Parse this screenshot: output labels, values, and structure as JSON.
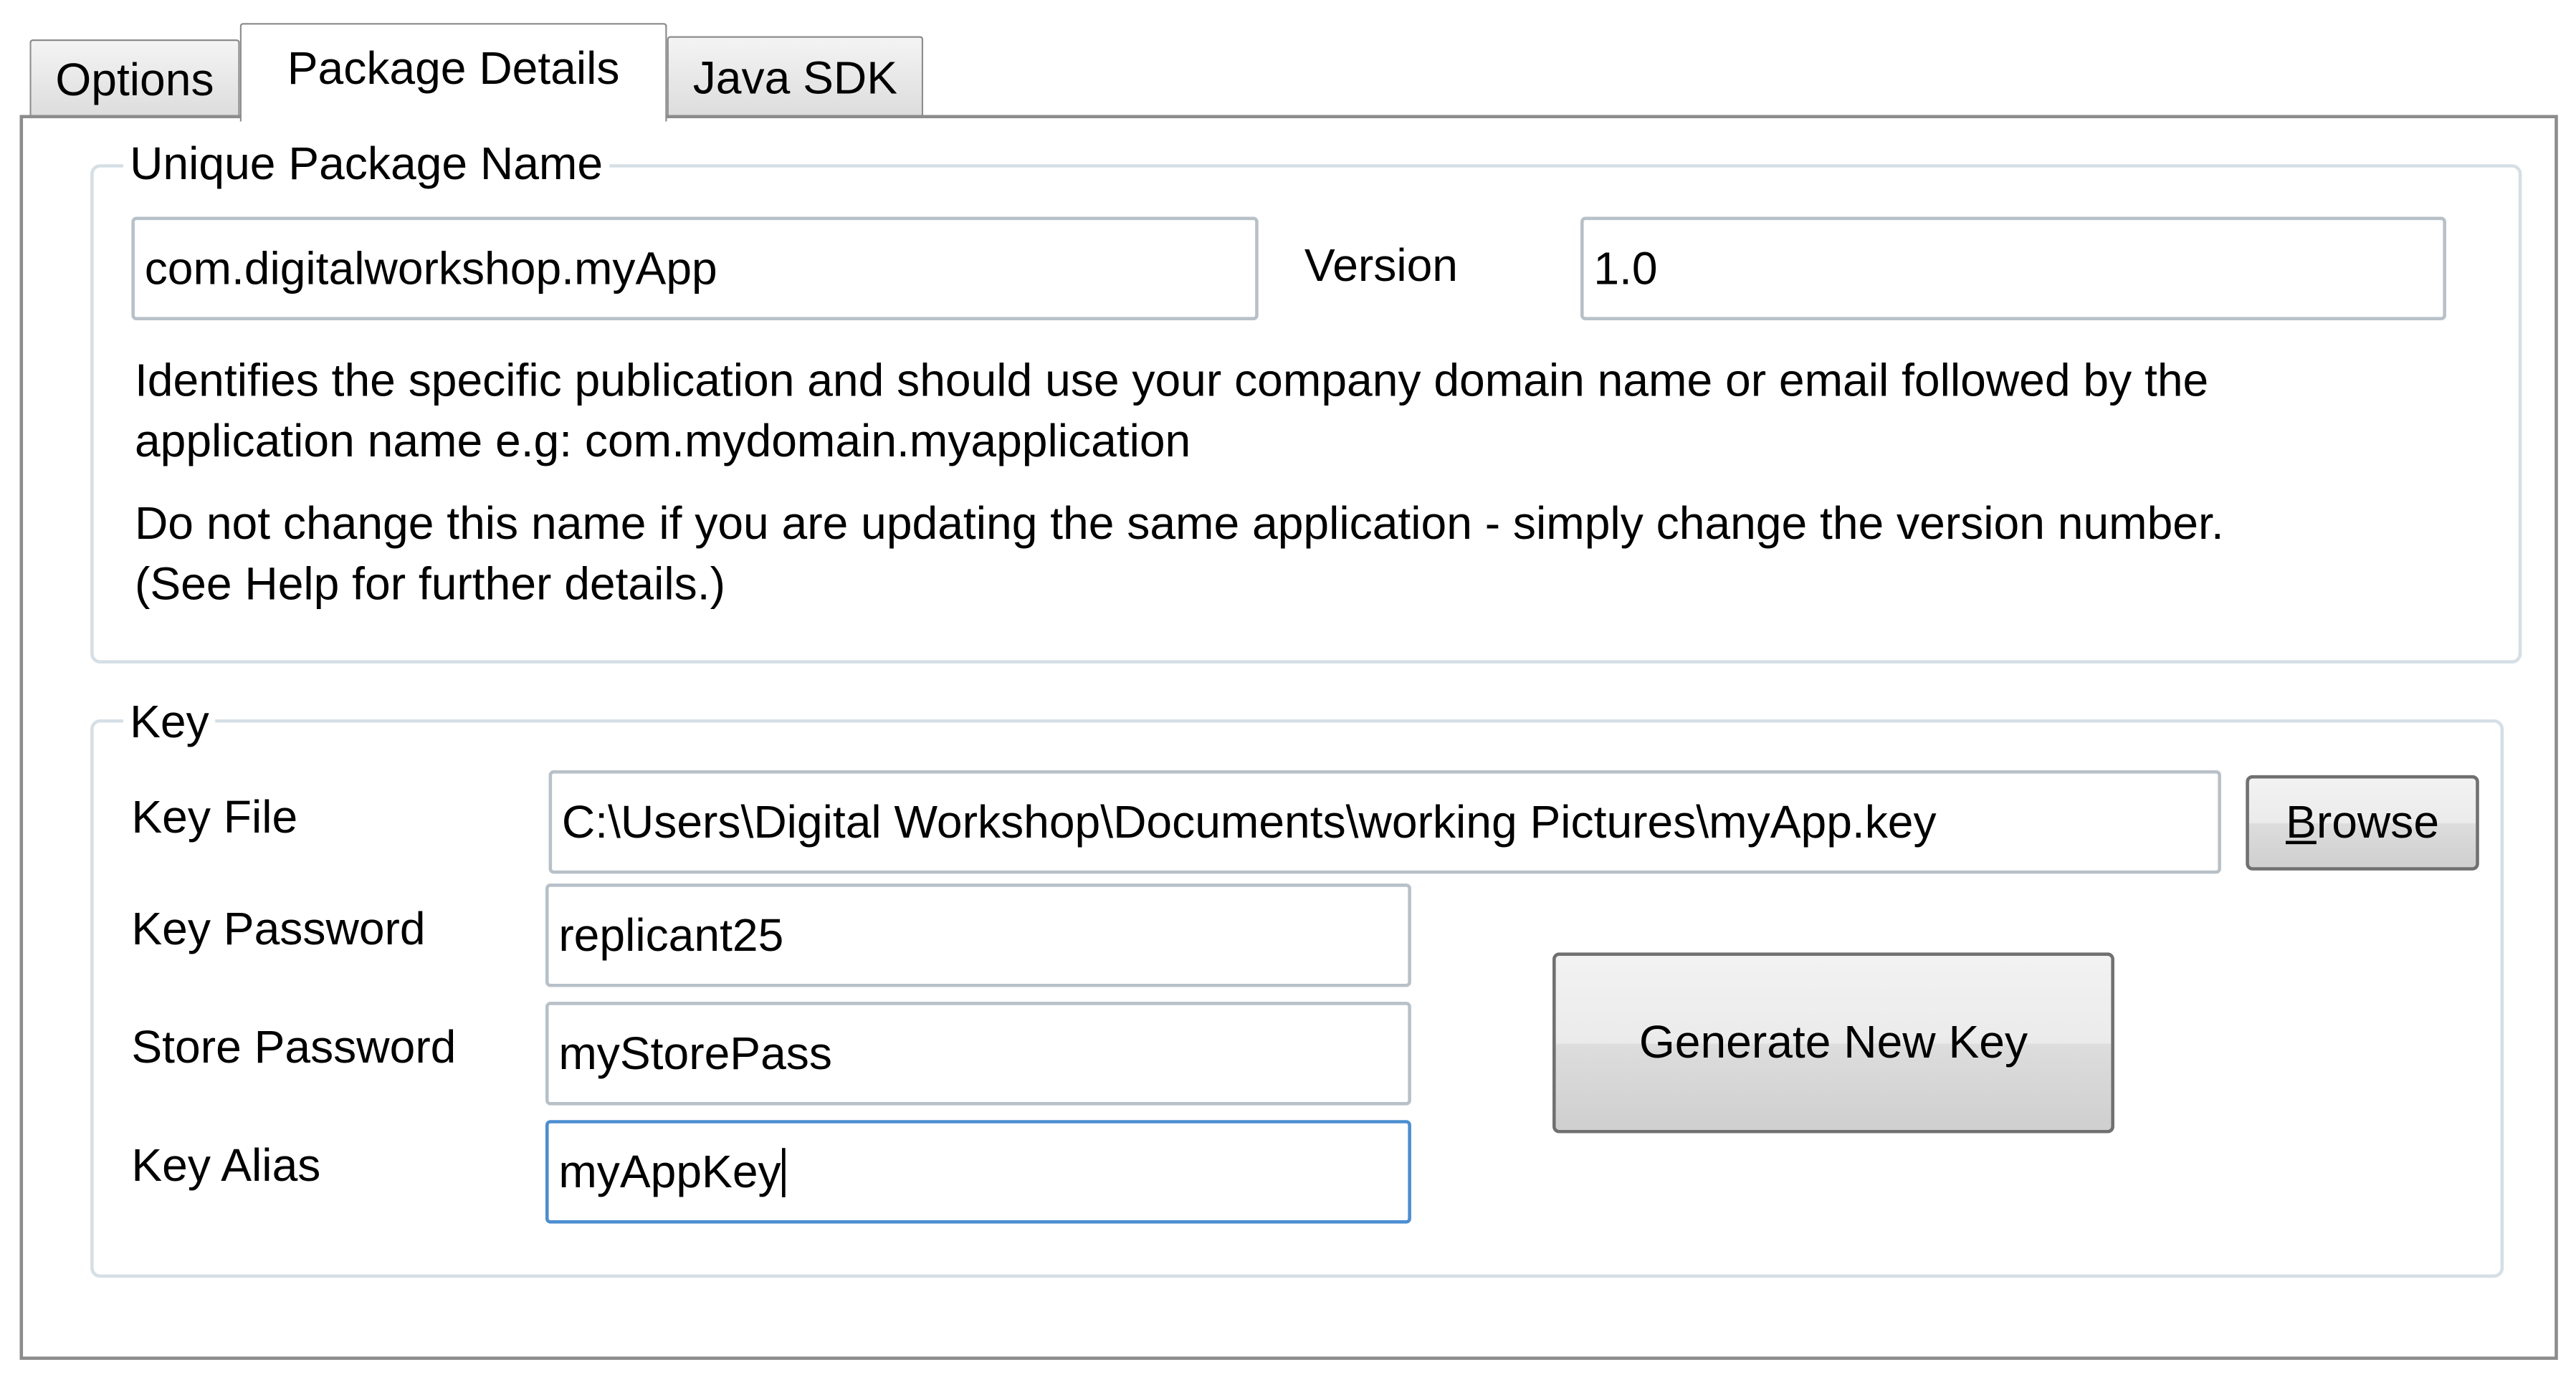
{
  "tabs": [
    {
      "label": "Options",
      "active": false
    },
    {
      "label": "Package Details",
      "active": true
    },
    {
      "label": "Java SDK",
      "active": false
    }
  ],
  "package_group": {
    "title": "Unique Package Name",
    "package_name_value": "com.digitalworkshop.myApp",
    "version_label": "Version",
    "version_value": "1.0",
    "description_line1": "Identifies the specific publication and should use your company domain name or email followed by the",
    "description_line2": "application name e.g: com.mydomain.myapplication",
    "note_line1": "Do not change this name if you are updating the same application - simply change the version number.",
    "note_line2": "(See Help for further details.)"
  },
  "key_group": {
    "title": "Key",
    "key_file_label": "Key File",
    "key_file_value": "C:\\Users\\Digital Workshop\\Documents\\working Pictures\\myApp.key",
    "browse_label_mnemonic": "B",
    "browse_label_rest": "rowse",
    "key_password_label": "Key Password",
    "key_password_value": "replicant25",
    "store_password_label": "Store Password",
    "store_password_value": "myStorePass",
    "key_alias_label": "Key Alias",
    "key_alias_value": "myAppKey",
    "generate_button_label": "Generate New Key"
  },
  "colors": {
    "tab_border": "#8c8c8c",
    "group_border": "#d5dfe5",
    "focus_border": "#4c8ed0"
  }
}
